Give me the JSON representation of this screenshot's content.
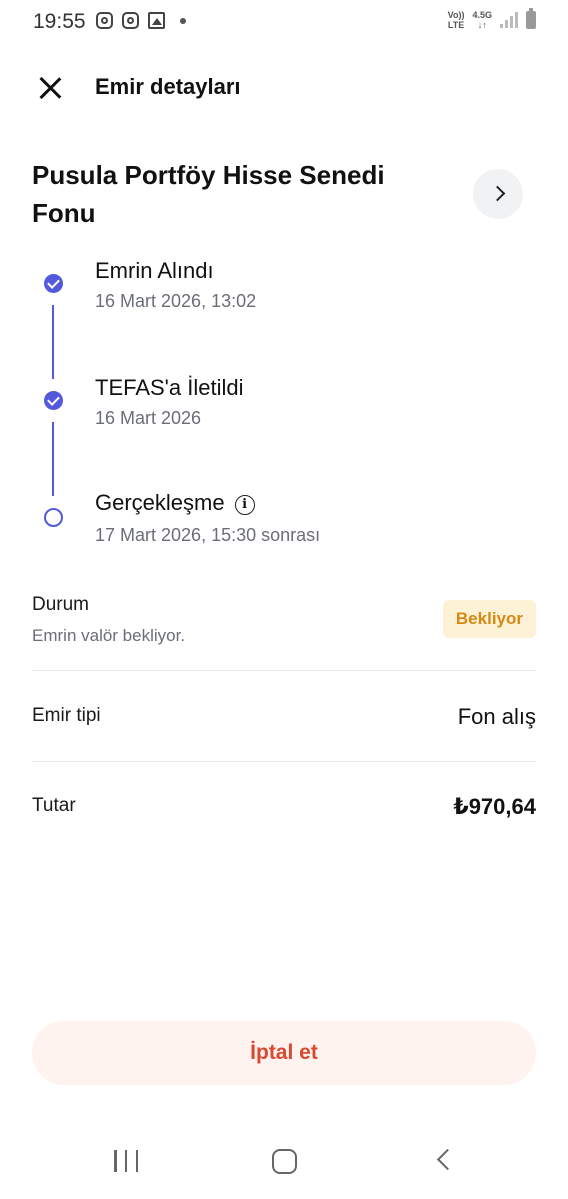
{
  "status_bar": {
    "time": "19:55",
    "network_top": "Vo))",
    "network_bottom": "LTE",
    "speed_top": "4.5G",
    "speed_bottom": "↓↑"
  },
  "header": {
    "title": "Emir detayları"
  },
  "fund": {
    "name": "Pusula Portföy Hisse Senedi Fonu"
  },
  "timeline": [
    {
      "label": "Emrin Alındı",
      "date": "16 Mart 2026, 13:02",
      "done": true
    },
    {
      "label": "TEFAS'a İletildi",
      "date": "16 Mart 2026",
      "done": true
    },
    {
      "label": "Gerçekleşme",
      "date": "17 Mart 2026, 15:30 sonrası",
      "done": false
    }
  ],
  "details": {
    "status_label": "Durum",
    "status_sub": "Emrin valör bekliyor.",
    "status_badge": "Bekliyor",
    "order_type_label": "Emir tipi",
    "order_type_value": "Fon alış",
    "amount_label": "Tutar",
    "amount_value": "₺970,64"
  },
  "actions": {
    "cancel_label": "İptal et"
  },
  "colors": {
    "accent": "#5259dc",
    "badge_bg": "#fdf2d5",
    "badge_text": "#d48a14",
    "cancel_bg": "#fff3f0",
    "cancel_text": "#d9482f"
  }
}
